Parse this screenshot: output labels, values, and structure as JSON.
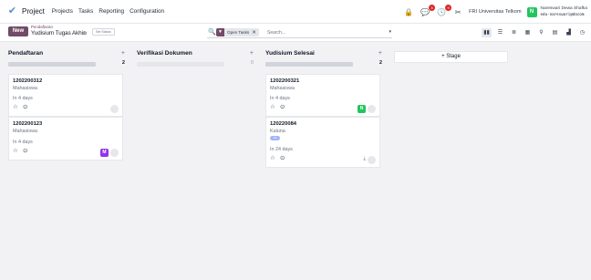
{
  "navbar": {
    "app_name": "Project",
    "menu": [
      "Projects",
      "Tasks",
      "Reporting",
      "Configuration"
    ],
    "activity_badge": "5",
    "clock_badge": "9",
    "company": "FRI Universitas Telkom",
    "user_initial": "N",
    "user_name": "Nareswari Dewa Shafka",
    "user_email": "edu-nareswari@docom"
  },
  "controlbar": {
    "new_label": "New",
    "breadcrumb_parent": "Pendaftaran",
    "breadcrumb_current": "Yudisium Tugas Akhir",
    "set_status": "Set Status",
    "facet_label": "Open Tasks",
    "search_placeholder": "Search..."
  },
  "columns": [
    {
      "title": "Pendaftaran",
      "count": "2",
      "cards": [
        {
          "title": "1202200312",
          "subtitle": "Mahasiswa",
          "days": "In 4 days"
        },
        {
          "title": "1202200123",
          "subtitle": "Mahasiswa",
          "days": "In 4 days",
          "avatar": "M"
        }
      ]
    },
    {
      "title": "Verifikasi Dokumen",
      "count": "0",
      "cards": []
    },
    {
      "title": "Yudisium Selesai",
      "count": "2",
      "cards": [
        {
          "title": "1202200321",
          "subtitle": "Mahasiswa",
          "days": "In 4 days",
          "avatar": "N"
        },
        {
          "title": "120220084",
          "subtitle": "Kaluna",
          "tag": "S1",
          "days": "In 24 days"
        }
      ]
    }
  ],
  "add_stage_label": "Stage",
  "colors": {
    "brand": "#714b67",
    "green": "#22c55e",
    "purple": "#9333ea"
  },
  "icons": [
    "check-logo-icon",
    "lock-icon",
    "chat-icon",
    "clock-icon",
    "tools-icon",
    "search-icon",
    "filter-icon",
    "kanban-icon",
    "list-icon",
    "star-icon"
  ]
}
